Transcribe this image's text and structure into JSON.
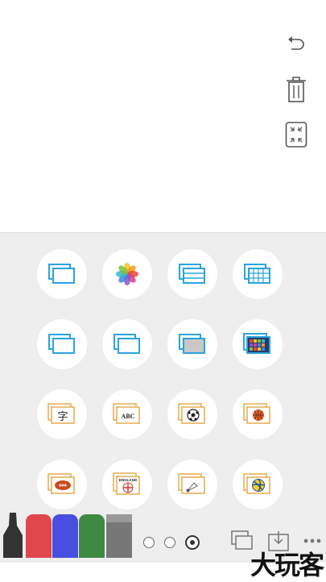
{
  "toolbar": {
    "undo_icon": "undo-icon",
    "delete_icon": "trash-icon",
    "fullscreen_icon": "collapse-screen-icon"
  },
  "backgrounds": [
    {
      "name": "blank-card"
    },
    {
      "name": "photo-library"
    },
    {
      "name": "lined-card"
    },
    {
      "name": "grid-card"
    },
    {
      "name": "blank-card-2"
    },
    {
      "name": "blank-card-3"
    },
    {
      "name": "gray-card"
    },
    {
      "name": "color-grid-card"
    },
    {
      "name": "chinese-char-card",
      "text": "字"
    },
    {
      "name": "abc-card",
      "text": "ABC"
    },
    {
      "name": "soccer-card"
    },
    {
      "name": "basketball-card"
    },
    {
      "name": "football-card"
    },
    {
      "name": "england-card",
      "text": "ENGLAND"
    },
    {
      "name": "badminton-card"
    },
    {
      "name": "volleyball-card"
    }
  ],
  "markers": [
    {
      "name": "black-marker",
      "color": "#333333"
    },
    {
      "name": "red-marker",
      "color": "#e0474c"
    },
    {
      "name": "blue-marker",
      "color": "#4a4ee0"
    },
    {
      "name": "green-marker",
      "color": "#3f8a43"
    },
    {
      "name": "eraser",
      "color": "#777777"
    }
  ],
  "pager": {
    "pages": 3,
    "active": 3
  },
  "brand": {
    "text": "大玩客"
  }
}
